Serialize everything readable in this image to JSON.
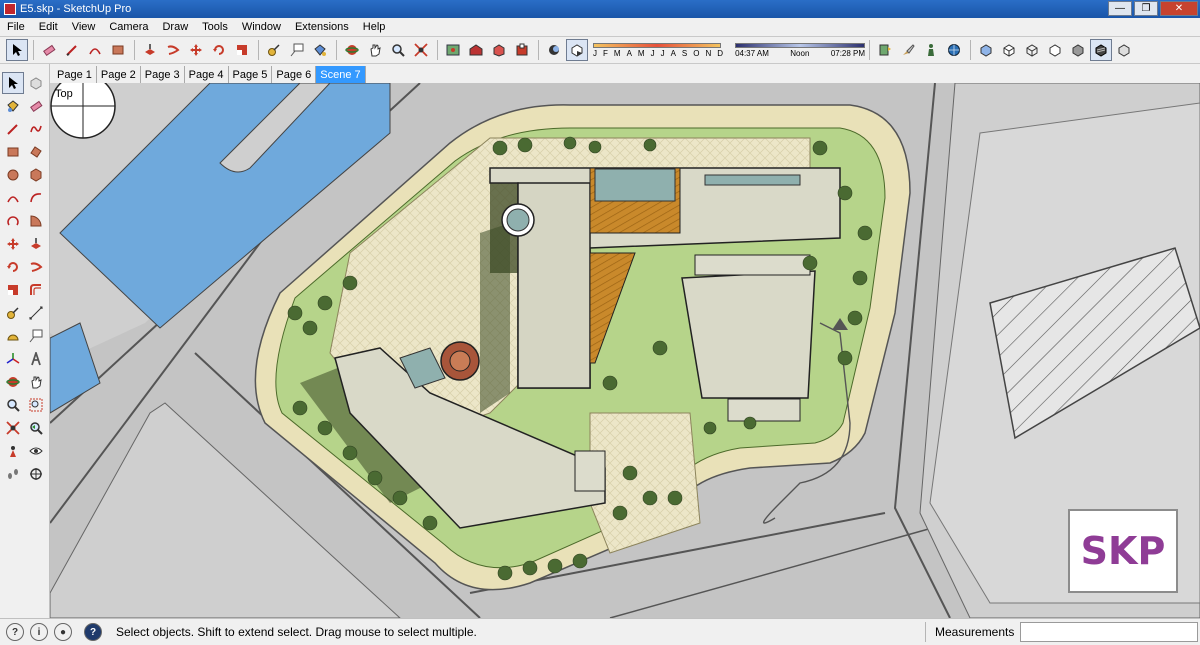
{
  "window": {
    "title": "E5.skp - SketchUp Pro"
  },
  "menu": [
    "File",
    "Edit",
    "View",
    "Camera",
    "Draw",
    "Tools",
    "Window",
    "Extensions",
    "Help"
  ],
  "shadow": {
    "months": [
      "J",
      "F",
      "M",
      "A",
      "M",
      "J",
      "J",
      "A",
      "S",
      "O",
      "N",
      "D"
    ],
    "time_start": "04:37 AM",
    "time_mid": "Noon",
    "time_end": "07:28 PM"
  },
  "scenes": {
    "tabs": [
      "Page 1",
      "Page 2",
      "Page 3",
      "Page 4",
      "Page 5",
      "Page 6",
      "Scene 7"
    ],
    "active_index": 6
  },
  "viewport": {
    "view_name": "Top",
    "watermark": "SKP"
  },
  "status": {
    "message": "Select objects. Shift to extend select. Drag mouse to select multiple.",
    "measurements_label": "Measurements",
    "measurements_value": ""
  },
  "colors": {
    "water": "#6fa9dc",
    "lawn": "#b6d48a",
    "paving": "#ece6c8",
    "building": "#d9d9c8",
    "road": "#c8c8c8",
    "accent": "#8f3c96"
  }
}
